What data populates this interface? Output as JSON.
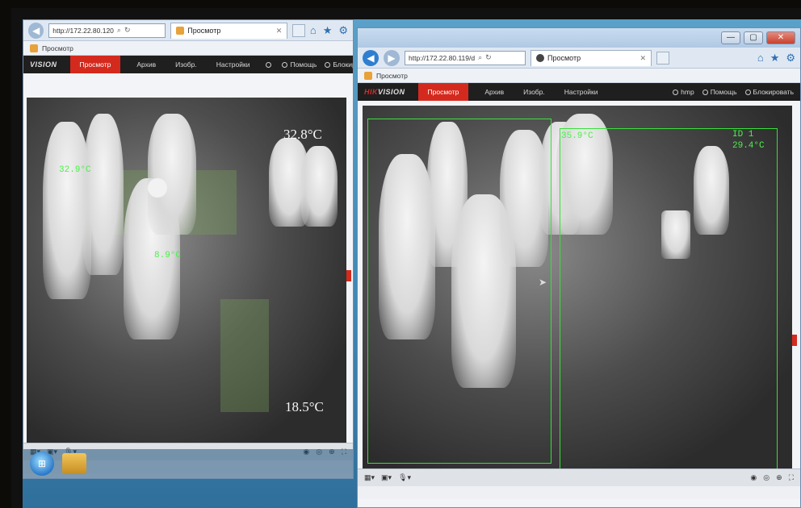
{
  "left_window": {
    "address": "http://172.22.80.120",
    "tab_title": "Просмотр",
    "fav_title": "Просмотр",
    "logo": {
      "prefix": "",
      "brand": "VISION"
    },
    "menu": [
      "Просмотр",
      "Архив",
      "Изобр.",
      "Настройки"
    ],
    "active_menu": "Просмотр",
    "user": {
      "name": "",
      "help": "Помощь",
      "logout": "Блокировать"
    },
    "temps": {
      "green_top": "32.9°C",
      "green_mid": "8.9°C",
      "white_top": "32.8°C",
      "white_bottom": "18.5°C"
    }
  },
  "right_window": {
    "address": "http://172.22.80.119/d",
    "tab_title": "Просмотр",
    "fav_title": "Просмотр",
    "logo": {
      "prefix": "HIK",
      "brand": "VISION"
    },
    "menu": [
      "Просмотр",
      "Архив",
      "Изобр.",
      "Настройки"
    ],
    "active_menu": "Просмотр",
    "user": {
      "name": "hmp",
      "help": "Помощь",
      "logout": "Блокировать"
    },
    "temps": {
      "roi_left": "35.9°C",
      "roi_right_id": "ID 1",
      "roi_right_temp": "29.4°C"
    }
  },
  "colors": {
    "accent_red": "#d42a1e",
    "roi_green": "#38e03a",
    "navbar_dark": "#1f1f1f"
  },
  "icons": [
    "back-icon",
    "forward-icon",
    "search-icon",
    "refresh-icon",
    "home-icon",
    "star-icon",
    "gear-icon",
    "user-icon",
    "help-icon",
    "logout-icon",
    "close-icon",
    "minimize-icon",
    "maximize-icon"
  ]
}
